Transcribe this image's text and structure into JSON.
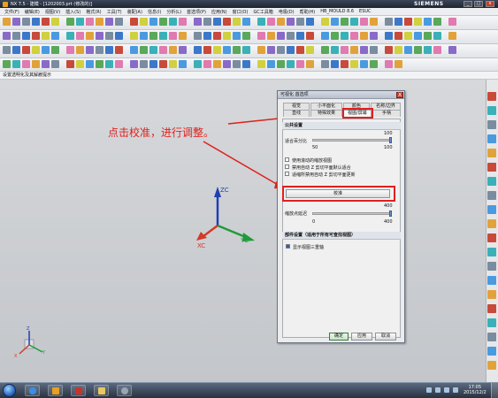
{
  "window": {
    "title": "NX 7.5 - 建模 - [1202003.prt (修改的)]",
    "brand": "SIEMENS",
    "min_label": "_",
    "max_label": "□",
    "close_label": "x"
  },
  "menubar": {
    "items": [
      "文件(F)",
      "编辑(E)",
      "视图(V)",
      "插入(S)",
      "格式(R)",
      "工具(T)",
      "装配(A)",
      "信息(I)",
      "分析(L)",
      "首选项(P)",
      "应用(N)",
      "窗口(O)",
      "GC工具箱",
      "电极(D)",
      "帮助(H)",
      "HB_MOULD 8.6",
      "ESUC"
    ]
  },
  "status": {
    "prompt": "设置透明化及其解雇提示"
  },
  "annotation": {
    "text": "点击校准，进行调整。",
    "color": "#e0201c"
  },
  "dialog": {
    "title": "可视化 首选项",
    "close_label": "X",
    "tabs_row1": [
      "视觉",
      "小平面化",
      "颜色",
      "名称/边界"
    ],
    "tabs_row2": [
      "直线",
      "特殊效果",
      "视图/屏幕",
      "手柄"
    ],
    "active_tab": "视图/屏幕",
    "section_common": "公共设置",
    "lod_label": "适合百分比",
    "lod_min": "50",
    "lod_max": "100",
    "lod_value_label": "100",
    "lod_fraction": 1.0,
    "checkbox_1": "使用滚动的缩放视图",
    "checkbox_2": "禁用自动 Z 剪切平面默认适合",
    "checkbox_3": "适缩所禁用自动 Z 剪切平面更新",
    "calibrate_label": "校准",
    "zoom_label": "缩放点延迟",
    "zoom_value": "400",
    "zoom_min": "0",
    "zoom_max": "400",
    "zoom_fraction": 1.0,
    "section_part": "部件设置（适用于所有可查找视图）",
    "part_checkbox": "显示视图三重轴",
    "btn_ok": "确定",
    "btn_apply": "应用",
    "btn_cancel": "取消"
  },
  "triad": {
    "zc": "ZC",
    "yc": "YC",
    "xc": "XC",
    "mini_z": "Z",
    "mini_y": "Y",
    "mini_x": "X"
  },
  "taskbar": {
    "time": "17:05",
    "date": "2015/12/2"
  }
}
